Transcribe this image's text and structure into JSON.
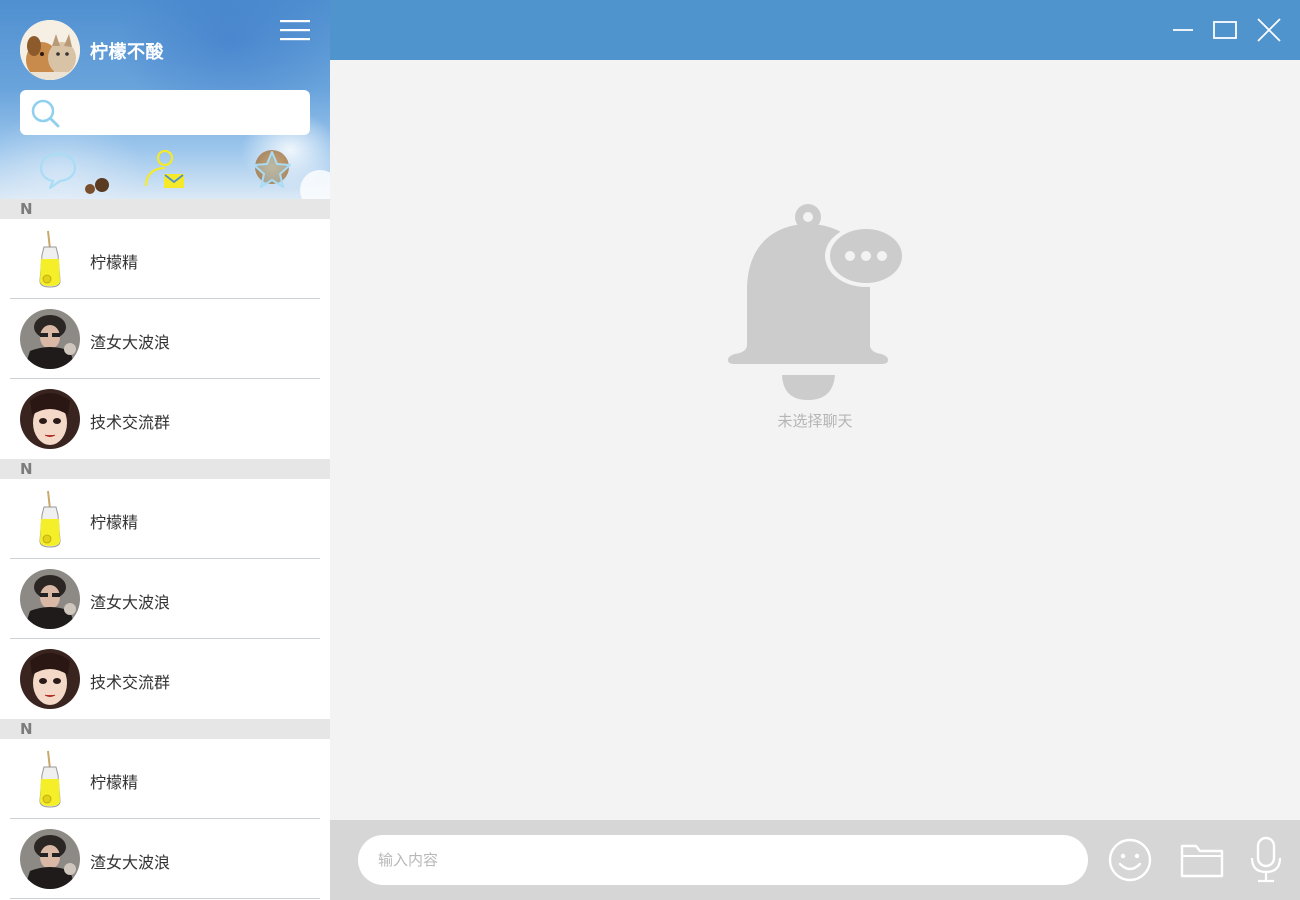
{
  "user": {
    "name": "柠檬不酸",
    "avatar_icon": "cat-dog-avatar"
  },
  "search": {
    "placeholder": ""
  },
  "side_tabs": [
    {
      "name": "chat-tab",
      "icon": "chat-bubble-icon",
      "active": false
    },
    {
      "name": "contacts-tab",
      "icon": "contact-mail-icon",
      "active": true
    },
    {
      "name": "favorites-tab",
      "icon": "star-icon",
      "active": false
    }
  ],
  "contact_groups": [
    {
      "letter": "N",
      "contacts": [
        {
          "name": "柠檬精",
          "avatar": "lemon-drink"
        },
        {
          "name": "渣女大波浪",
          "avatar": "person-photo"
        },
        {
          "name": "技术交流群",
          "avatar": "anime-girl"
        }
      ]
    },
    {
      "letter": "N",
      "contacts": [
        {
          "name": "柠檬精",
          "avatar": "lemon-drink"
        },
        {
          "name": "渣女大波浪",
          "avatar": "person-photo"
        },
        {
          "name": "技术交流群",
          "avatar": "anime-girl"
        }
      ]
    },
    {
      "letter": "N",
      "contacts": [
        {
          "name": "柠檬精",
          "avatar": "lemon-drink"
        },
        {
          "name": "渣女大波浪",
          "avatar": "person-photo"
        }
      ]
    }
  ],
  "window_controls": [
    "minimize",
    "maximize",
    "close"
  ],
  "chat": {
    "empty_text": "未选择聊天"
  },
  "input_bar": {
    "placeholder": "输入内容",
    "value": ""
  },
  "colors": {
    "titlebar": "#4f94cd",
    "chat_bg": "#f3f3f3",
    "input_bar_bg": "#d6d6d6",
    "group_header_bg": "#e6e6e6",
    "empty_icon": "#cccccc"
  }
}
